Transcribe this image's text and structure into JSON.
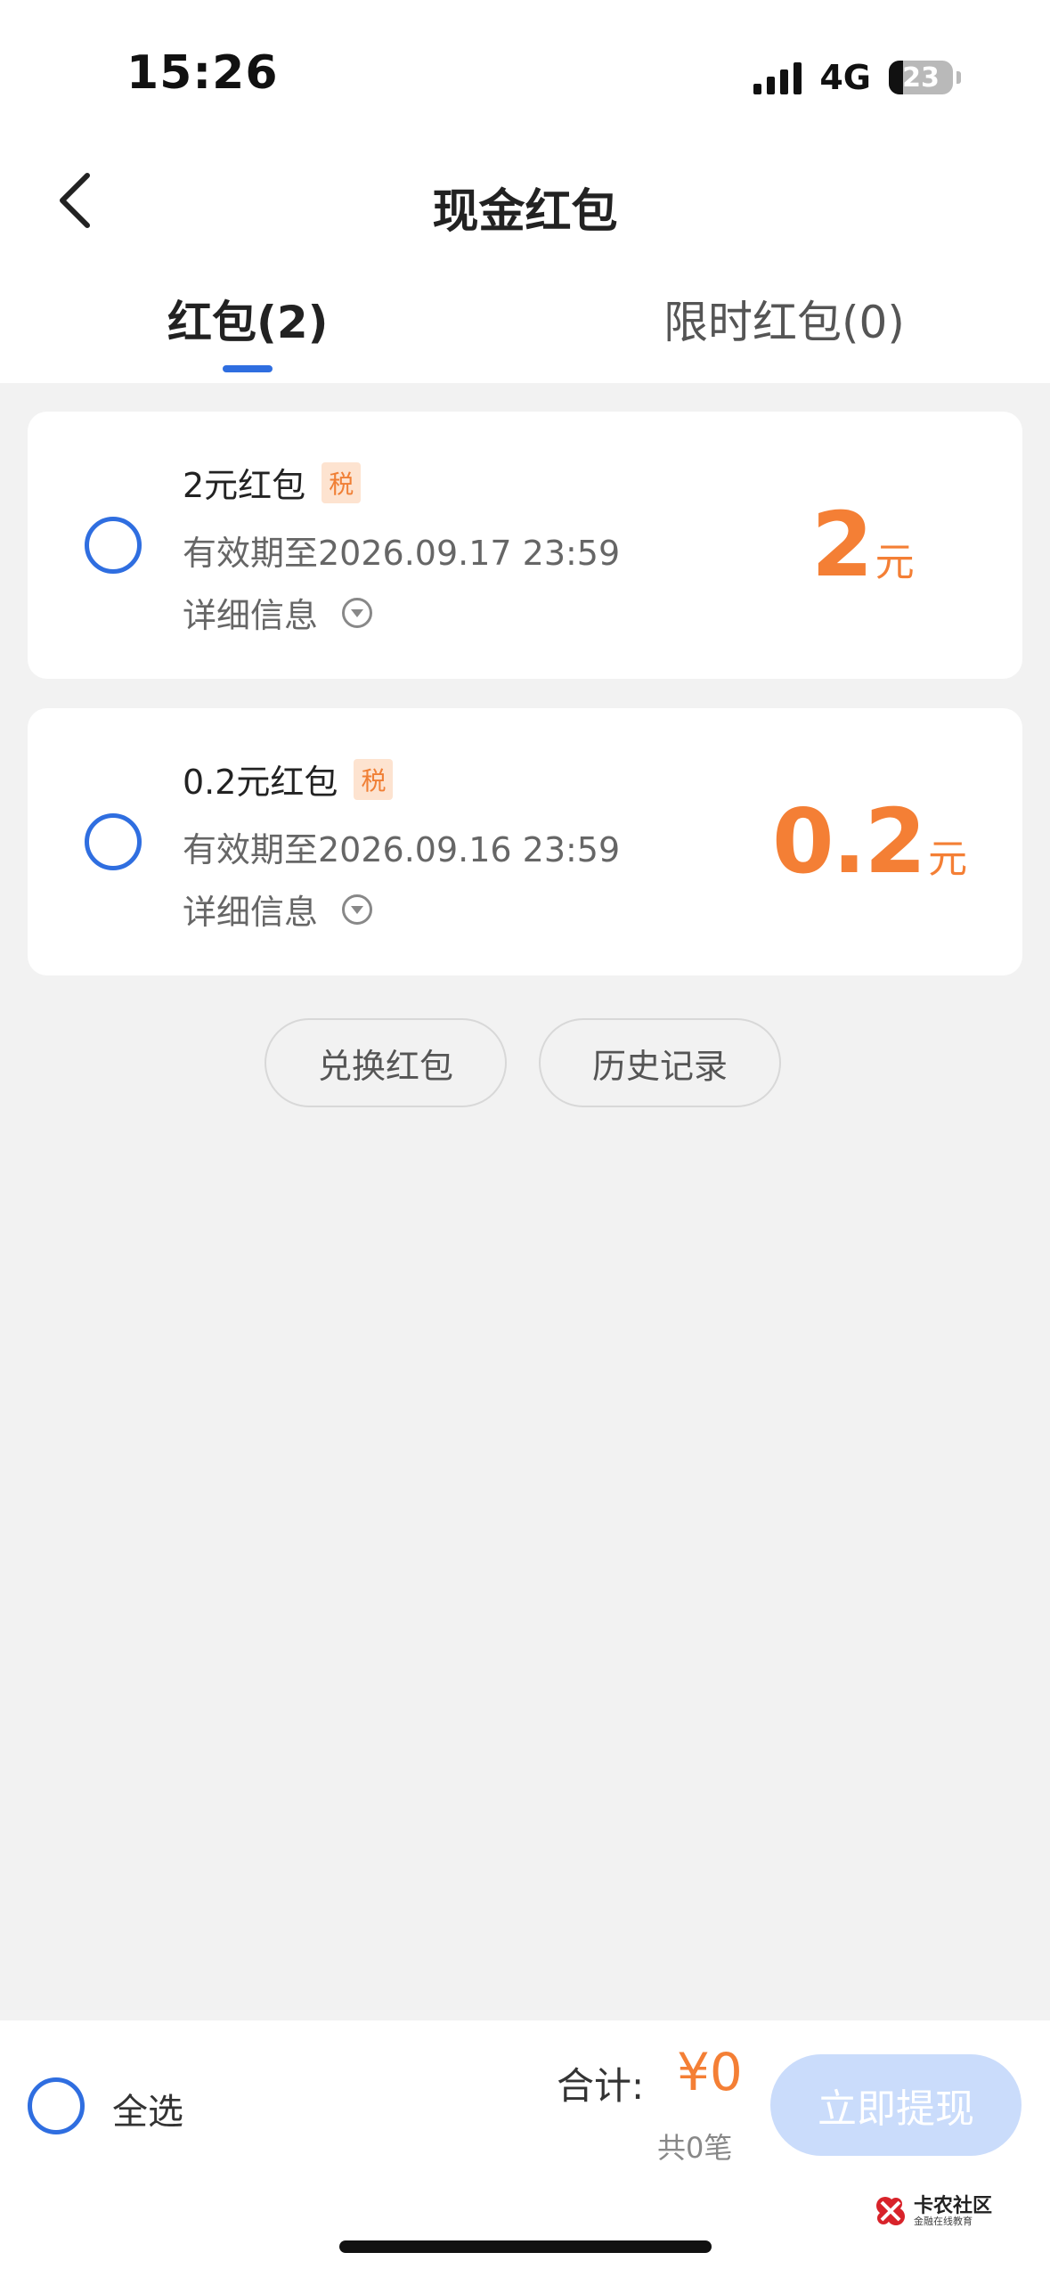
{
  "status_bar": {
    "time": "15:26",
    "network": "4G",
    "battery": "23"
  },
  "header": {
    "title": "现金红包"
  },
  "tabs": [
    {
      "label": "红包(2)",
      "active": true
    },
    {
      "label": "限时红包(0)",
      "active": false
    }
  ],
  "packets": [
    {
      "title": "2元红包",
      "badge": "税",
      "validity": "有效期至2026.09.17 23:59",
      "detail_label": "详细信息",
      "amount": "2",
      "unit": "元"
    },
    {
      "title": "0.2元红包",
      "badge": "税",
      "validity": "有效期至2026.09.16 23:59",
      "detail_label": "详细信息",
      "amount": "0.2",
      "unit": "元"
    }
  ],
  "actions": {
    "redeem_label": "兑换红包",
    "history_label": "历史记录"
  },
  "footer": {
    "select_all_label": "全选",
    "total_label": "合计:",
    "total_value": "¥0",
    "count_text": "共0笔",
    "withdraw_label": "立即提现"
  },
  "watermark": {
    "main": "卡农社区",
    "sub": "金融在线教育"
  },
  "colors": {
    "accent_blue": "#2f6ee0",
    "amount_orange": "#f47f35",
    "badge_bg": "#fde3d0",
    "disabled_button": "#cadcfb",
    "page_bg": "#f2f2f2"
  },
  "icons": {
    "back": "chevron-left-icon",
    "detail": "circle-caret-down-icon",
    "signal": "cellular-signal-icon",
    "battery": "battery-icon"
  }
}
